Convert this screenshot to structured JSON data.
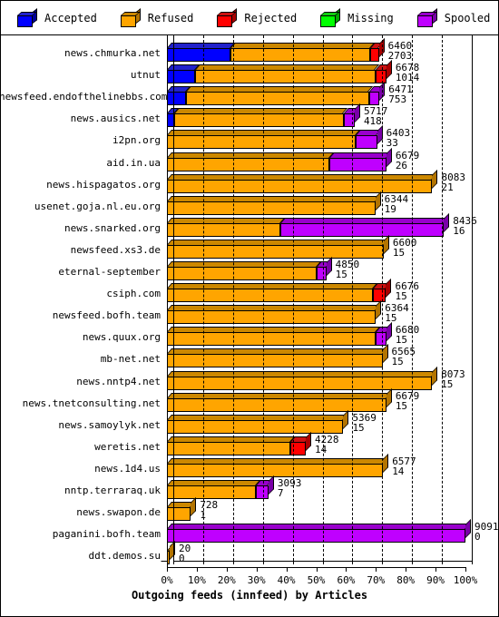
{
  "legend": {
    "items": [
      {
        "label": "Accepted",
        "color": "#0000ff",
        "dark": "#000099",
        "top": "#2222cc"
      },
      {
        "label": "Refused",
        "color": "#ffa500",
        "dark": "#b37400",
        "top": "#cc8800"
      },
      {
        "label": "Rejected",
        "color": "#ff0000",
        "dark": "#aa0000",
        "top": "#cc1111"
      },
      {
        "label": "Missing",
        "color": "#00ff00",
        "dark": "#00aa00",
        "top": "#11cc11"
      },
      {
        "label": "Spooled",
        "color": "#bf00ff",
        "dark": "#7a00a8",
        "top": "#9900cc"
      }
    ]
  },
  "axis": {
    "x_title": "Outgoing feeds (innfeed) by Articles",
    "x_ticks": [
      "0%",
      "10%",
      "20%",
      "30%",
      "40%",
      "50%",
      "60%",
      "70%",
      "80%",
      "90%",
      "100%"
    ]
  },
  "chart_data": {
    "type": "bar",
    "orientation": "horizontal",
    "stacked": true,
    "normalized": true,
    "title": "Outgoing feeds (innfeed) by Articles",
    "xlabel": "Outgoing feeds (innfeed) by Articles",
    "ylabel": "",
    "xlim": [
      0,
      100
    ],
    "xtick_labels": [
      "0%",
      "10%",
      "20%",
      "30%",
      "40%",
      "50%",
      "60%",
      "70%",
      "80%",
      "90%",
      "100%"
    ],
    "grid": true,
    "legend_position": "top",
    "series": [
      {
        "name": "Accepted",
        "color": "#0000ff"
      },
      {
        "name": "Refused",
        "color": "#ffa500"
      },
      {
        "name": "Rejected",
        "color": "#ff0000"
      },
      {
        "name": "Missing",
        "color": "#00ff00"
      },
      {
        "name": "Spooled",
        "color": "#bf00ff"
      }
    ],
    "categories": [
      "news.chmurka.net",
      "utnut",
      "newsfeed.endofthelinebbs.com",
      "news.ausics.net",
      "i2pn.org",
      "aid.in.ua",
      "news.hispagatos.org",
      "usenet.goja.nl.eu.org",
      "news.snarked.org",
      "newsfeed.xs3.de",
      "eternal-september",
      "csiph.com",
      "newsfeed.bofh.team",
      "news.quux.org",
      "mb-net.net",
      "news.nntp4.net",
      "news.tnetconsulting.net",
      "news.samoylyk.net",
      "weretis.net",
      "news.1d4.us",
      "nntp.terraraq.uk",
      "news.swapon.de",
      "paganini.bofh.team",
      "ddt.demos.su"
    ],
    "rows": [
      {
        "category": "news.chmurka.net",
        "total": 6460,
        "secondary": 2703,
        "bar_pct": 71.0,
        "segments": [
          {
            "series": "Accepted",
            "pct": 30.0
          },
          {
            "series": "Refused",
            "pct": 66.0
          },
          {
            "series": "Rejected",
            "pct": 4.0
          }
        ]
      },
      {
        "category": "utnut",
        "total": 6678,
        "secondary": 1014,
        "bar_pct": 73.5,
        "segments": [
          {
            "series": "Accepted",
            "pct": 13.0
          },
          {
            "series": "Refused",
            "pct": 82.0
          },
          {
            "series": "Rejected",
            "pct": 5.0
          }
        ]
      },
      {
        "category": "newsfeed.endofthelinebbs.com",
        "total": 6471,
        "secondary": 753,
        "bar_pct": 71.2,
        "segments": [
          {
            "series": "Accepted",
            "pct": 9.0
          },
          {
            "series": "Refused",
            "pct": 86.0
          },
          {
            "series": "Spooled",
            "pct": 5.0
          }
        ]
      },
      {
        "category": "news.ausics.net",
        "total": 5717,
        "secondary": 418,
        "bar_pct": 62.9,
        "segments": [
          {
            "series": "Accepted",
            "pct": 4.0
          },
          {
            "series": "Refused",
            "pct": 90.0
          },
          {
            "series": "Spooled",
            "pct": 6.0
          }
        ]
      },
      {
        "category": "i2pn.org",
        "total": 6403,
        "secondary": 33,
        "bar_pct": 70.4,
        "segments": [
          {
            "series": "Refused",
            "pct": 90.0
          },
          {
            "series": "Spooled",
            "pct": 10.0
          }
        ]
      },
      {
        "category": "aid.in.ua",
        "total": 6679,
        "secondary": 26,
        "bar_pct": 73.5,
        "segments": [
          {
            "series": "Refused",
            "pct": 74.0
          },
          {
            "series": "Spooled",
            "pct": 26.0
          }
        ]
      },
      {
        "category": "news.hispagatos.org",
        "total": 8083,
        "secondary": 21,
        "bar_pct": 88.9,
        "segments": [
          {
            "series": "Refused",
            "pct": 100.0
          }
        ]
      },
      {
        "category": "usenet.goja.nl.eu.org",
        "total": 6344,
        "secondary": 19,
        "bar_pct": 69.8,
        "segments": [
          {
            "series": "Refused",
            "pct": 100.0
          }
        ]
      },
      {
        "category": "news.snarked.org",
        "total": 8436,
        "secondary": 16,
        "bar_pct": 92.8,
        "segments": [
          {
            "series": "Refused",
            "pct": 41.0
          },
          {
            "series": "Spooled",
            "pct": 59.0
          }
        ]
      },
      {
        "category": "newsfeed.xs3.de",
        "total": 6600,
        "secondary": 15,
        "bar_pct": 72.6,
        "segments": [
          {
            "series": "Refused",
            "pct": 100.0
          }
        ]
      },
      {
        "category": "eternal-september",
        "total": 4850,
        "secondary": 15,
        "bar_pct": 53.4,
        "segments": [
          {
            "series": "Refused",
            "pct": 94.0
          },
          {
            "series": "Spooled",
            "pct": 6.0
          }
        ]
      },
      {
        "category": "csiph.com",
        "total": 6676,
        "secondary": 15,
        "bar_pct": 73.4,
        "segments": [
          {
            "series": "Refused",
            "pct": 94.0
          },
          {
            "series": "Rejected",
            "pct": 6.0
          }
        ]
      },
      {
        "category": "newsfeed.bofh.team",
        "total": 6364,
        "secondary": 15,
        "bar_pct": 70.0,
        "segments": [
          {
            "series": "Refused",
            "pct": 100.0
          }
        ]
      },
      {
        "category": "news.quux.org",
        "total": 6680,
        "secondary": 15,
        "bar_pct": 73.5,
        "segments": [
          {
            "series": "Refused",
            "pct": 95.0
          },
          {
            "series": "Spooled",
            "pct": 5.0
          }
        ]
      },
      {
        "category": "mb-net.net",
        "total": 6565,
        "secondary": 15,
        "bar_pct": 72.2,
        "segments": [
          {
            "series": "Refused",
            "pct": 100.0
          }
        ]
      },
      {
        "category": "news.nntp4.net",
        "total": 8073,
        "secondary": 15,
        "bar_pct": 88.8,
        "segments": [
          {
            "series": "Refused",
            "pct": 100.0
          }
        ]
      },
      {
        "category": "news.tnetconsulting.net",
        "total": 6679,
        "secondary": 15,
        "bar_pct": 73.5,
        "segments": [
          {
            "series": "Refused",
            "pct": 100.0
          }
        ]
      },
      {
        "category": "news.samoylyk.net",
        "total": 5369,
        "secondary": 15,
        "bar_pct": 59.1,
        "segments": [
          {
            "series": "Refused",
            "pct": 100.0
          }
        ]
      },
      {
        "category": "weretis.net",
        "total": 4228,
        "secondary": 14,
        "bar_pct": 46.5,
        "segments": [
          {
            "series": "Refused",
            "pct": 89.0
          },
          {
            "series": "Rejected",
            "pct": 11.0
          }
        ]
      },
      {
        "category": "news.1d4.us",
        "total": 6577,
        "secondary": 14,
        "bar_pct": 72.4,
        "segments": [
          {
            "series": "Refused",
            "pct": 100.0
          }
        ]
      },
      {
        "category": "nntp.terraraq.uk",
        "total": 3093,
        "secondary": 7,
        "bar_pct": 34.0,
        "segments": [
          {
            "series": "Refused",
            "pct": 88.0
          },
          {
            "series": "Spooled",
            "pct": 12.0
          }
        ]
      },
      {
        "category": "news.swapon.de",
        "total": 728,
        "secondary": 1,
        "bar_pct": 8.0,
        "segments": [
          {
            "series": "Refused",
            "pct": 100.0
          }
        ]
      },
      {
        "category": "paganini.bofh.team",
        "total": 9091,
        "secondary": 0,
        "bar_pct": 100.0,
        "segments": [
          {
            "series": "Spooled",
            "pct": 100.0
          }
        ]
      },
      {
        "category": "ddt.demos.su",
        "total": 20,
        "secondary": 0,
        "bar_pct": 0.9,
        "segments": [
          {
            "series": "Refused",
            "pct": 100.0
          }
        ]
      }
    ]
  }
}
